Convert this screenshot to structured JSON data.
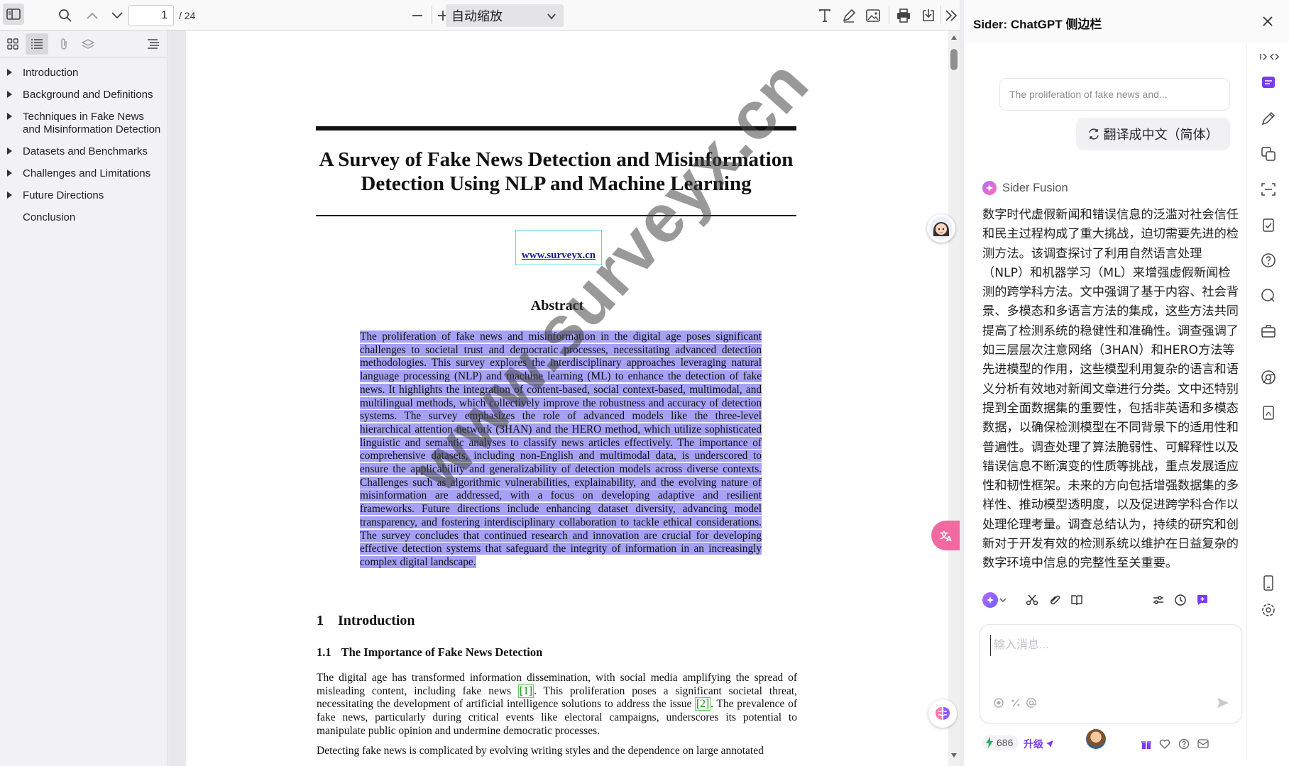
{
  "toolbar": {
    "page_current": "1",
    "page_total": "/ 24",
    "zoom_label": "自动缩放",
    "icons": [
      "sidebar-toggle-icon",
      "search-icon",
      "chevron-up-icon",
      "chevron-down-icon",
      "zoom-out-icon",
      "zoom-in-icon",
      "text-tool-icon",
      "draw-icon",
      "image-icon",
      "print-icon",
      "save-icon",
      "more-icon"
    ]
  },
  "outline": {
    "items": [
      {
        "label": "Introduction",
        "expandable": true
      },
      {
        "label": "Background and Definitions",
        "expandable": true
      },
      {
        "label": "Techniques in Fake News and Misinformation Detection",
        "expandable": true
      },
      {
        "label": "Datasets and Benchmarks",
        "expandable": true
      },
      {
        "label": "Challenges and Limitations",
        "expandable": true
      },
      {
        "label": "Future Directions",
        "expandable": true
      },
      {
        "label": "Conclusion",
        "expandable": false
      }
    ]
  },
  "paper": {
    "title": "A Survey of Fake News Detection and Misinformation Detection Using NLP and Machine Learning",
    "link": "www.surveyx.cn",
    "watermark": "www.surveyx.cn",
    "abstract_heading": "Abstract",
    "abstract": "The proliferation of fake news and misinformation in the digital age poses significant challenges to societal trust and democratic processes, necessitating advanced detection methodologies. This survey explores the interdisciplinary approaches leveraging natural language processing (NLP) and machine learning (ML) to enhance the detection of fake news. It highlights the integration of content-based, social context-based, multimodal, and multilingual methods, which collectively improve the robustness and accuracy of detection systems. The survey emphasizes the role of advanced models like the three-level hierarchical attention network (3HAN) and the HERO method, which utilize sophisticated linguistic and semantic analyses to classify news articles effectively. The importance of comprehensive datasets, including non-English and multimodal data, is underscored to ensure the applicability and generalizability of detection models across diverse contexts. Challenges such as algorithmic vulnerabilities, explainability, and the evolving nature of misinformation are addressed, with a focus on developing adaptive and resilient frameworks. Future directions include enhancing dataset diversity, advancing model transparency, and fostering interdisciplinary collaboration to tackle ethical considerations. The survey concludes that continued research and innovation are crucial for developing effective detection systems that safeguard the integrity of information in an increasingly complex digital landscape.",
    "section1_num": "1",
    "section1_title": "Introduction",
    "section11_num": "1.1",
    "section11_title": "The Importance of Fake News Detection",
    "para1_a": "The digital age has transformed information dissemination, with social media amplifying the spread of misleading content, including fake news ",
    "cite1": "[1]",
    "para1_b": ". This proliferation poses a significant societal threat, necessitating the development of artificial intelligence solutions to address the issue ",
    "cite2": "[2]",
    "para1_c": ". The prevalence of fake news, particularly during critical events like electoral campaigns, underscores its potential to manipulate public opinion and undermine democratic processes.",
    "para2": "Detecting fake news is complicated by evolving writing styles and the dependence on large annotated"
  },
  "sider": {
    "title": "Sider: ChatGPT 侧边栏",
    "quote": "The proliferation of fake news and...",
    "command": "翻译成中文（简体）",
    "bot_name": "Sider Fusion",
    "reply": "数字时代虚假新闻和错误信息的泛滥对社会信任和民主过程构成了重大挑战，迫切需要先进的检测方法。该调查探讨了利用自然语言处理（NLP）和机器学习（ML）来增强虚假新闻检测的跨学科方法。文中强调了基于内容、社会背景、多模态和多语言方法的集成，这些方法共同提高了检测系统的稳健性和准确性。调查强调了如三层层次注意网络（3HAN）和HERO方法等先进模型的作用，这些模型利用复杂的语言和语义分析有效地对新闻文章进行分类。文中还特别提到全面数据集的重要性，包括非英语和多模态数据，以确保检测模型在不同背景下的适用性和普遍性。调查处理了算法脆弱性、可解释性以及错误信息不断演变的性质等挑战，重点发展适应性和韧性框架。未来的方向包括增强数据集的多样性、推动模型透明度，以及促进跨学科合作以处理伦理考量。调查总结认为，持续的研究和创新对于开发有效的检测系统以维护在日益复杂的数字环境中信息的完整性至关重要。",
    "input_placeholder": "输入消息...",
    "credits": "686",
    "upgrade": "升级",
    "brand_color": "#7a3cf0"
  }
}
